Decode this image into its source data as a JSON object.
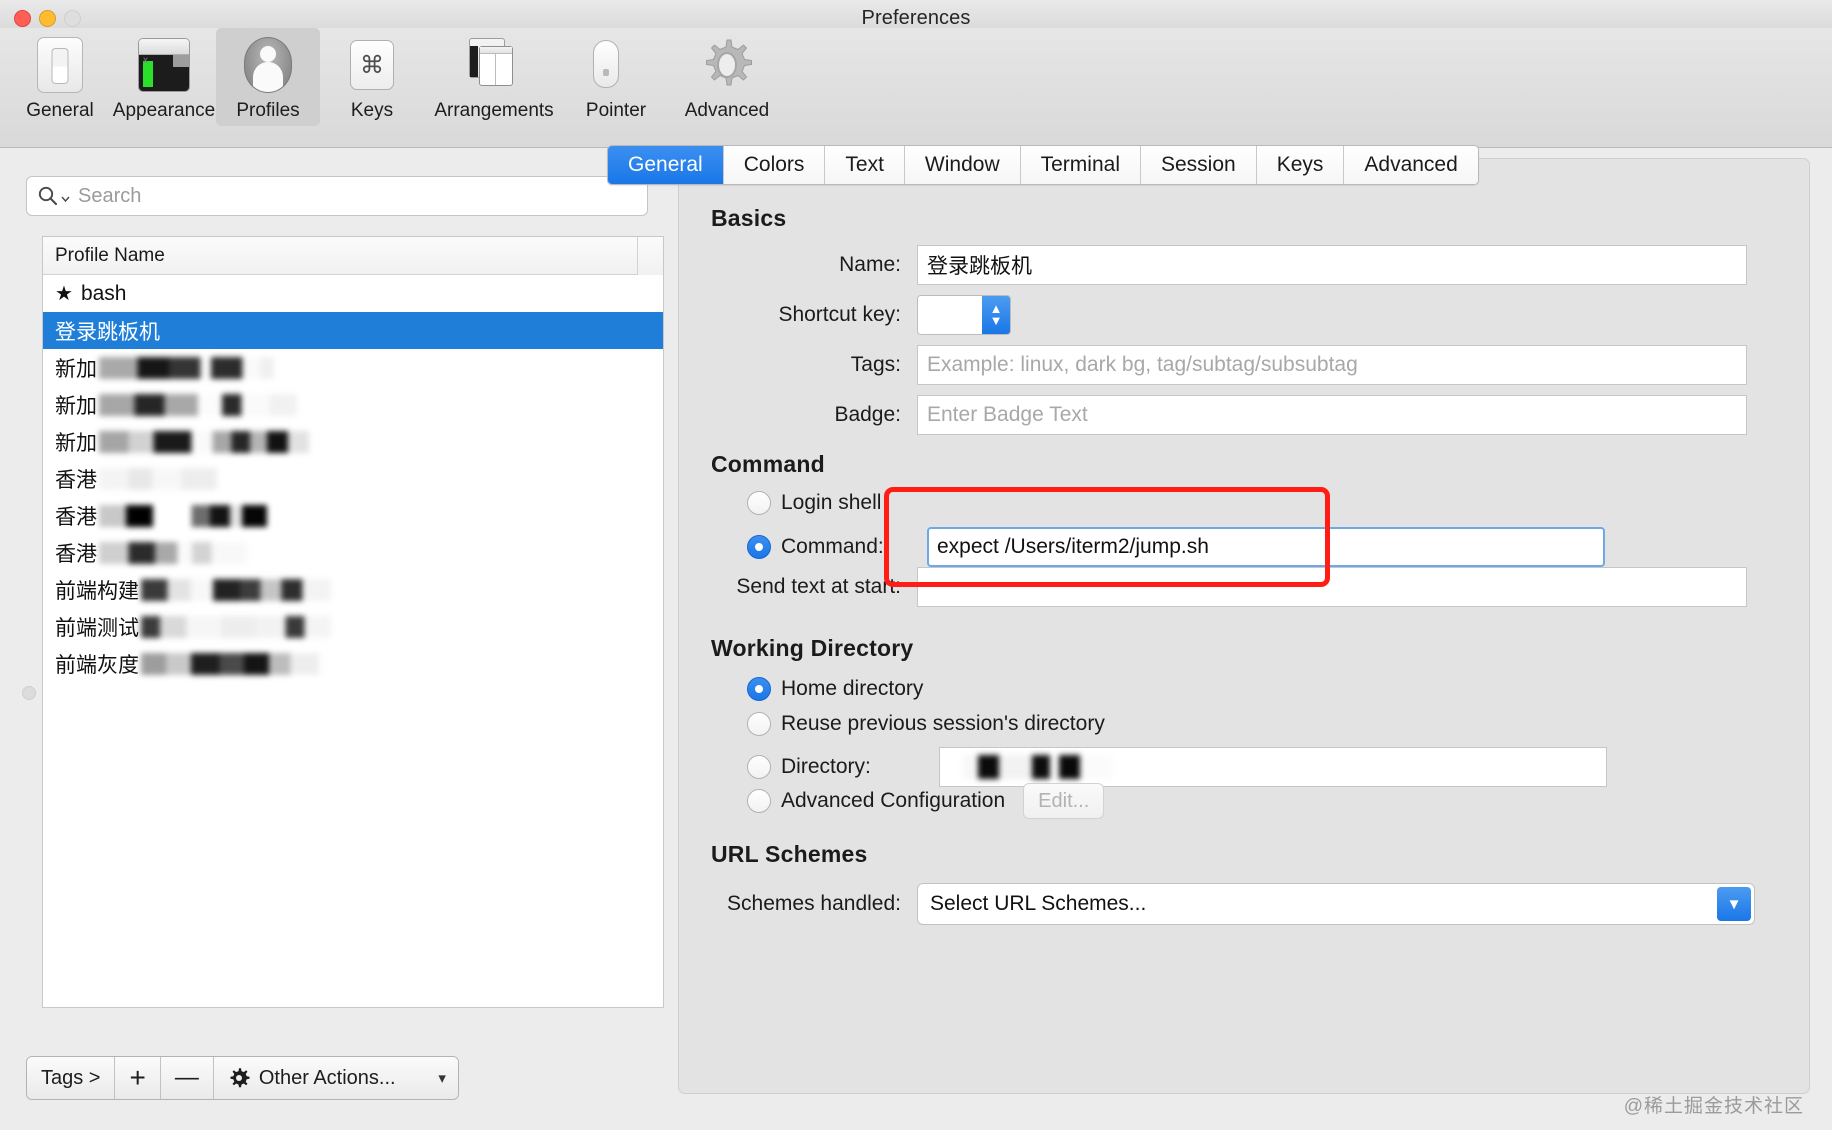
{
  "window": {
    "title": "Preferences",
    "traffic_lights": [
      "close",
      "minimize",
      "zoom"
    ]
  },
  "toolbar": {
    "items": [
      {
        "label": "General",
        "icon": "general-icon",
        "selected": false
      },
      {
        "label": "Appearance",
        "icon": "appearance-icon",
        "selected": false
      },
      {
        "label": "Profiles",
        "icon": "profiles-icon",
        "selected": true
      },
      {
        "label": "Keys",
        "icon": "keys-icon",
        "selected": false
      },
      {
        "label": "Arrangements",
        "icon": "arrangements-icon",
        "selected": false
      },
      {
        "label": "Pointer",
        "icon": "pointer-icon",
        "selected": false
      },
      {
        "label": "Advanced",
        "icon": "advanced-gear-icon",
        "selected": false
      }
    ]
  },
  "sidebar": {
    "search_placeholder": "Search",
    "list_header": "Profile Name",
    "profiles": [
      {
        "name": "bash",
        "starred": true,
        "selected": false,
        "redacted": false
      },
      {
        "name": "登录跳板机",
        "starred": false,
        "selected": true,
        "redacted": false
      },
      {
        "name": "新加",
        "starred": false,
        "selected": false,
        "redacted": true
      },
      {
        "name": "新加",
        "starred": false,
        "selected": false,
        "redacted": true
      },
      {
        "name": "新加",
        "starred": false,
        "selected": false,
        "redacted": true
      },
      {
        "name": "香港",
        "starred": false,
        "selected": false,
        "redacted": true
      },
      {
        "name": "香港",
        "starred": false,
        "selected": false,
        "redacted": true
      },
      {
        "name": "香港",
        "starred": false,
        "selected": false,
        "redacted": true
      },
      {
        "name": "前端构建",
        "starred": false,
        "selected": false,
        "redacted": true
      },
      {
        "name": "前端测试",
        "starred": false,
        "selected": false,
        "redacted": true
      },
      {
        "name": "前端灰度",
        "starred": false,
        "selected": false,
        "redacted": true
      }
    ],
    "bottom_bar": {
      "tags_label": "Tags >",
      "add_label": "+",
      "remove_label": "—",
      "other_actions_label": "Other Actions...",
      "other_actions_chevron": "▾"
    }
  },
  "tabs": [
    {
      "label": "General",
      "active": true
    },
    {
      "label": "Colors",
      "active": false
    },
    {
      "label": "Text",
      "active": false
    },
    {
      "label": "Window",
      "active": false
    },
    {
      "label": "Terminal",
      "active": false
    },
    {
      "label": "Session",
      "active": false
    },
    {
      "label": "Keys",
      "active": false
    },
    {
      "label": "Advanced",
      "active": false
    }
  ],
  "basics": {
    "heading": "Basics",
    "name_label": "Name:",
    "name_value": "登录跳板机",
    "shortcut_label": "Shortcut key:",
    "shortcut_value": "",
    "tags_label": "Tags:",
    "tags_placeholder": "Example: linux, dark bg, tag/subtag/subsubtag",
    "badge_label": "Badge:",
    "badge_placeholder": "Enter Badge Text"
  },
  "command": {
    "heading": "Command",
    "login_shell_label": "Login shell",
    "login_shell_selected": false,
    "command_label": "Command:",
    "command_selected": true,
    "command_value": "expect /Users/iterm2/jump.sh",
    "send_text_label": "Send text at start:",
    "send_text_value": "",
    "annotation_color": "#ff1d16"
  },
  "working_directory": {
    "heading": "Working Directory",
    "options": [
      {
        "label": "Home directory",
        "selected": true
      },
      {
        "label": "Reuse previous session's directory",
        "selected": false
      },
      {
        "label": "Directory:",
        "selected": false
      },
      {
        "label": "Advanced Configuration",
        "selected": false
      }
    ],
    "directory_value_redacted": true,
    "edit_button_label": "Edit...",
    "edit_button_disabled": true
  },
  "url_schemes": {
    "heading": "URL Schemes",
    "schemes_label": "Schemes handled:",
    "schemes_value": "Select URL Schemes..."
  },
  "watermark": "@稀土掘金技术社区",
  "colors": {
    "accent_blue": "#1a77e8",
    "selection_blue": "#1f7fd8",
    "annotation_red": "#ff1d16",
    "window_bg": "#ececec",
    "panel_bg": "#e3e3e3"
  }
}
